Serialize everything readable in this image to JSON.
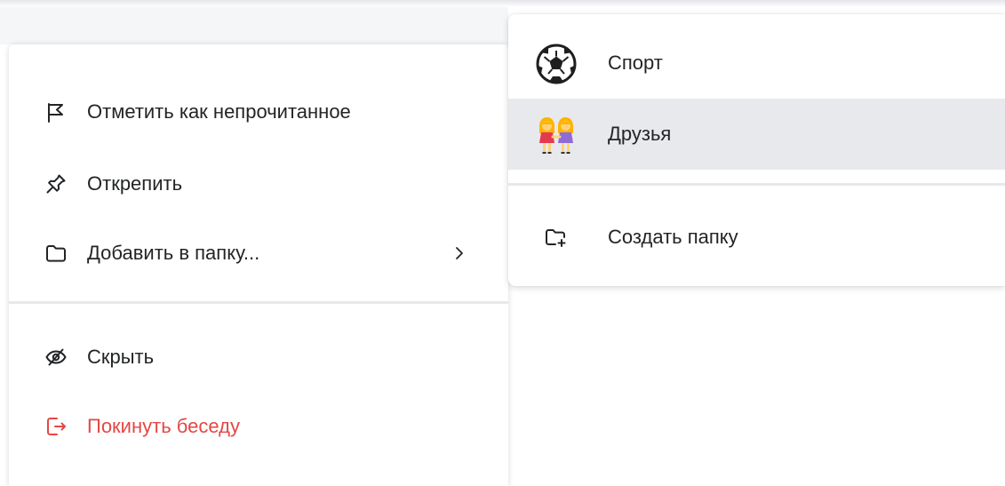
{
  "context_menu": {
    "items": [
      {
        "label": "Отметить как непрочитанное",
        "icon": "flag-icon"
      },
      {
        "label": "Открепить",
        "icon": "unpin-icon"
      },
      {
        "label": "Добавить в папку...",
        "icon": "folder-icon",
        "submenu_indicator": "chevron-right-icon"
      },
      {
        "label": "Скрыть",
        "icon": "eye-crossed-icon"
      },
      {
        "label": "Покинуть беседу",
        "icon": "leave-icon",
        "color": "#e64646"
      }
    ]
  },
  "folder_submenu": {
    "folders": [
      {
        "label": "Спорт",
        "icon": "soccer-ball-icon"
      },
      {
        "label": "Друзья",
        "icon": "two-women-icon",
        "hovered": true
      }
    ],
    "create_folder": {
      "label": "Создать папку",
      "icon": "folder-add-icon"
    }
  },
  "colors": {
    "danger": "#e64646",
    "text": "#222426",
    "icon": "#222426",
    "hover_bg": "#e8e9ec",
    "divider": "#e7e8ec"
  }
}
